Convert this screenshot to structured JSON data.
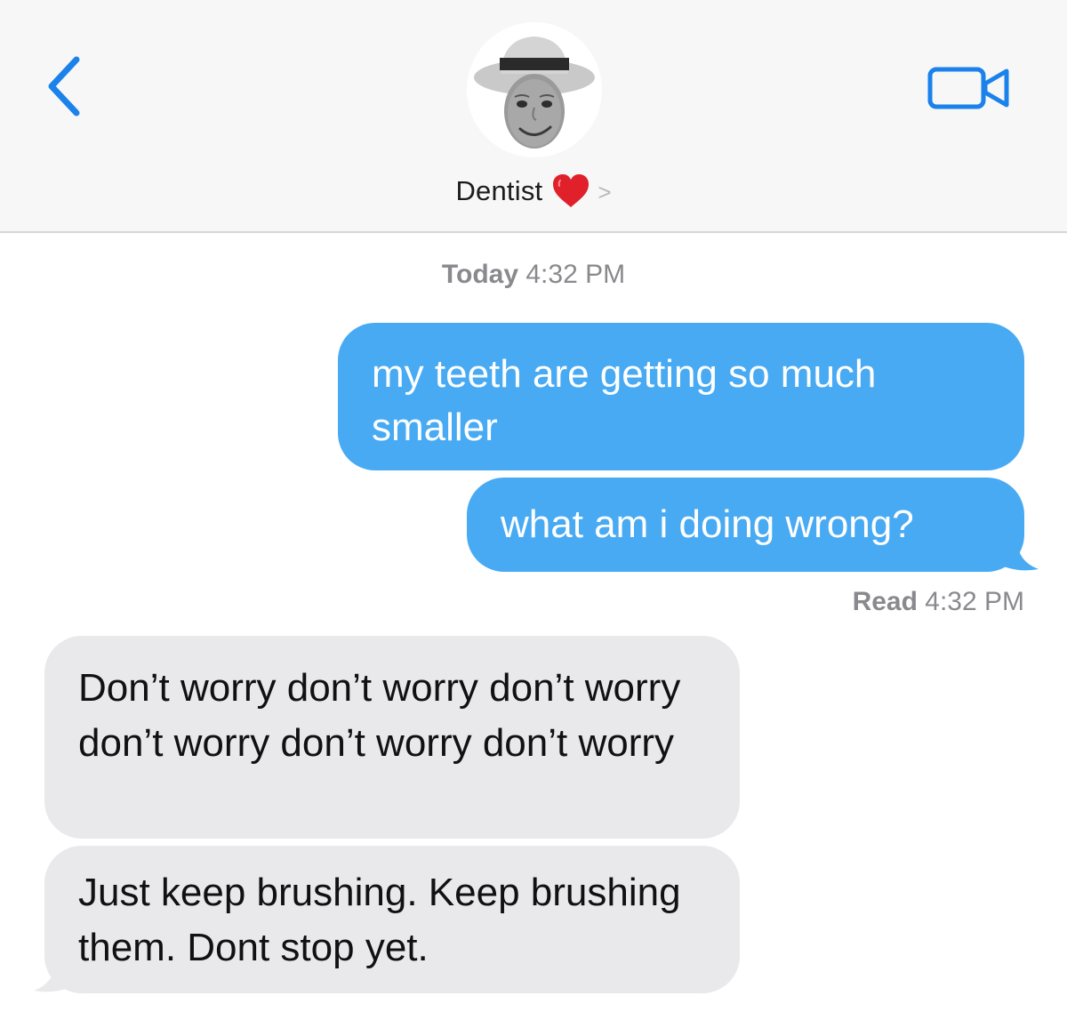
{
  "header": {
    "back_icon": "chevron-left-icon",
    "video_icon": "video-camera-icon",
    "avatar_icon": "memoji-avatar",
    "contact_name": "Dentist",
    "heart_icon": "red-heart-icon",
    "chevron_icon": "chevron-right-icon",
    "chevron_glyph": ">",
    "accent_color": "#1a82ea"
  },
  "timestamp": {
    "day": "Today",
    "time": "4:32 PM"
  },
  "messages": [
    {
      "direction": "outgoing",
      "text": "my teeth are getting so much smaller"
    },
    {
      "direction": "outgoing",
      "text": "what am i doing wrong?"
    },
    {
      "direction": "incoming",
      "text": "Don’t worry don’t worry don’t worry don’t worry don’t worry don’t worry"
    },
    {
      "direction": "incoming",
      "text": "Just keep brushing. Keep brushing them. Dont stop yet."
    }
  ],
  "read_receipt": {
    "label": "Read",
    "time": "4:32 PM"
  },
  "colors": {
    "outgoing_bubble": "#48aaf3",
    "incoming_bubble": "#e9e9eb",
    "heart": "#e0202a"
  }
}
